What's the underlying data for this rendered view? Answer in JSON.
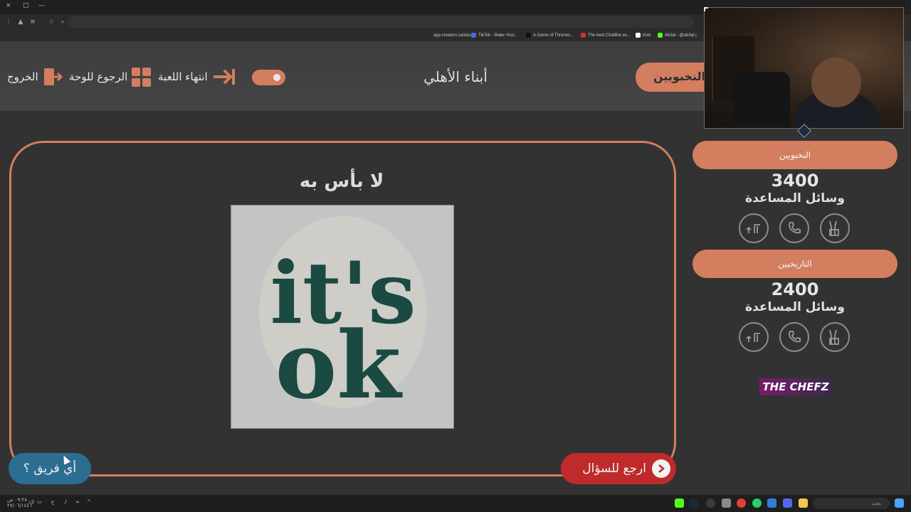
{
  "browser": {
    "window_controls": [
      "×",
      "□",
      "—"
    ],
    "bookmarks": [
      {
        "label": "app.creators.sa/das...",
        "color": "#2d2d2d"
      },
      {
        "label": "TikTok - Make Your...",
        "color": "#4b6bd6"
      },
      {
        "label": "A Game of Thrones...",
        "color": "#111111"
      },
      {
        "label": "The best ChatBot an...",
        "color": "#d0312d"
      },
      {
        "label": "Kick",
        "color": "#ffffff"
      },
      {
        "label": "Ab3al - @ab3al |",
        "color": "#53fc18"
      }
    ]
  },
  "header": {
    "title": "أبناء الأهلي",
    "exit_label": "الخروج",
    "board_label": "الرجوع للوحة",
    "end_game_label": "انتهاء اللعبة",
    "active_team_tab": "النخبويين"
  },
  "question": {
    "title": "لا بأس به",
    "image_text_line1": "it's",
    "image_text_line2": "ok",
    "which_team_label": "أي فريق ؟",
    "back_label": "ارجع للسؤال"
  },
  "teams": [
    {
      "name": "النخبويين",
      "score": "3400",
      "aids_label": "وسائل المساعدة"
    },
    {
      "name": "التاريخيين",
      "score": "2400",
      "aids_label": "وسائل المساعدة"
    }
  ],
  "aid_icons": [
    "two-fingers-icon",
    "phone-icon",
    "double-answer-icon"
  ],
  "sponsor_logo": "THE CHEFZ",
  "taskbar": {
    "search_placeholder": "بحث",
    "clock": "٠٩:٢٨ ص",
    "date": "٢٧/٠٦/١٤٤٦"
  },
  "colors": {
    "accent": "#d27e5f",
    "background": "#323232",
    "blue_button": "#2c6e92",
    "red_button": "#bf2a2a",
    "image_text": "#1a4a42"
  }
}
